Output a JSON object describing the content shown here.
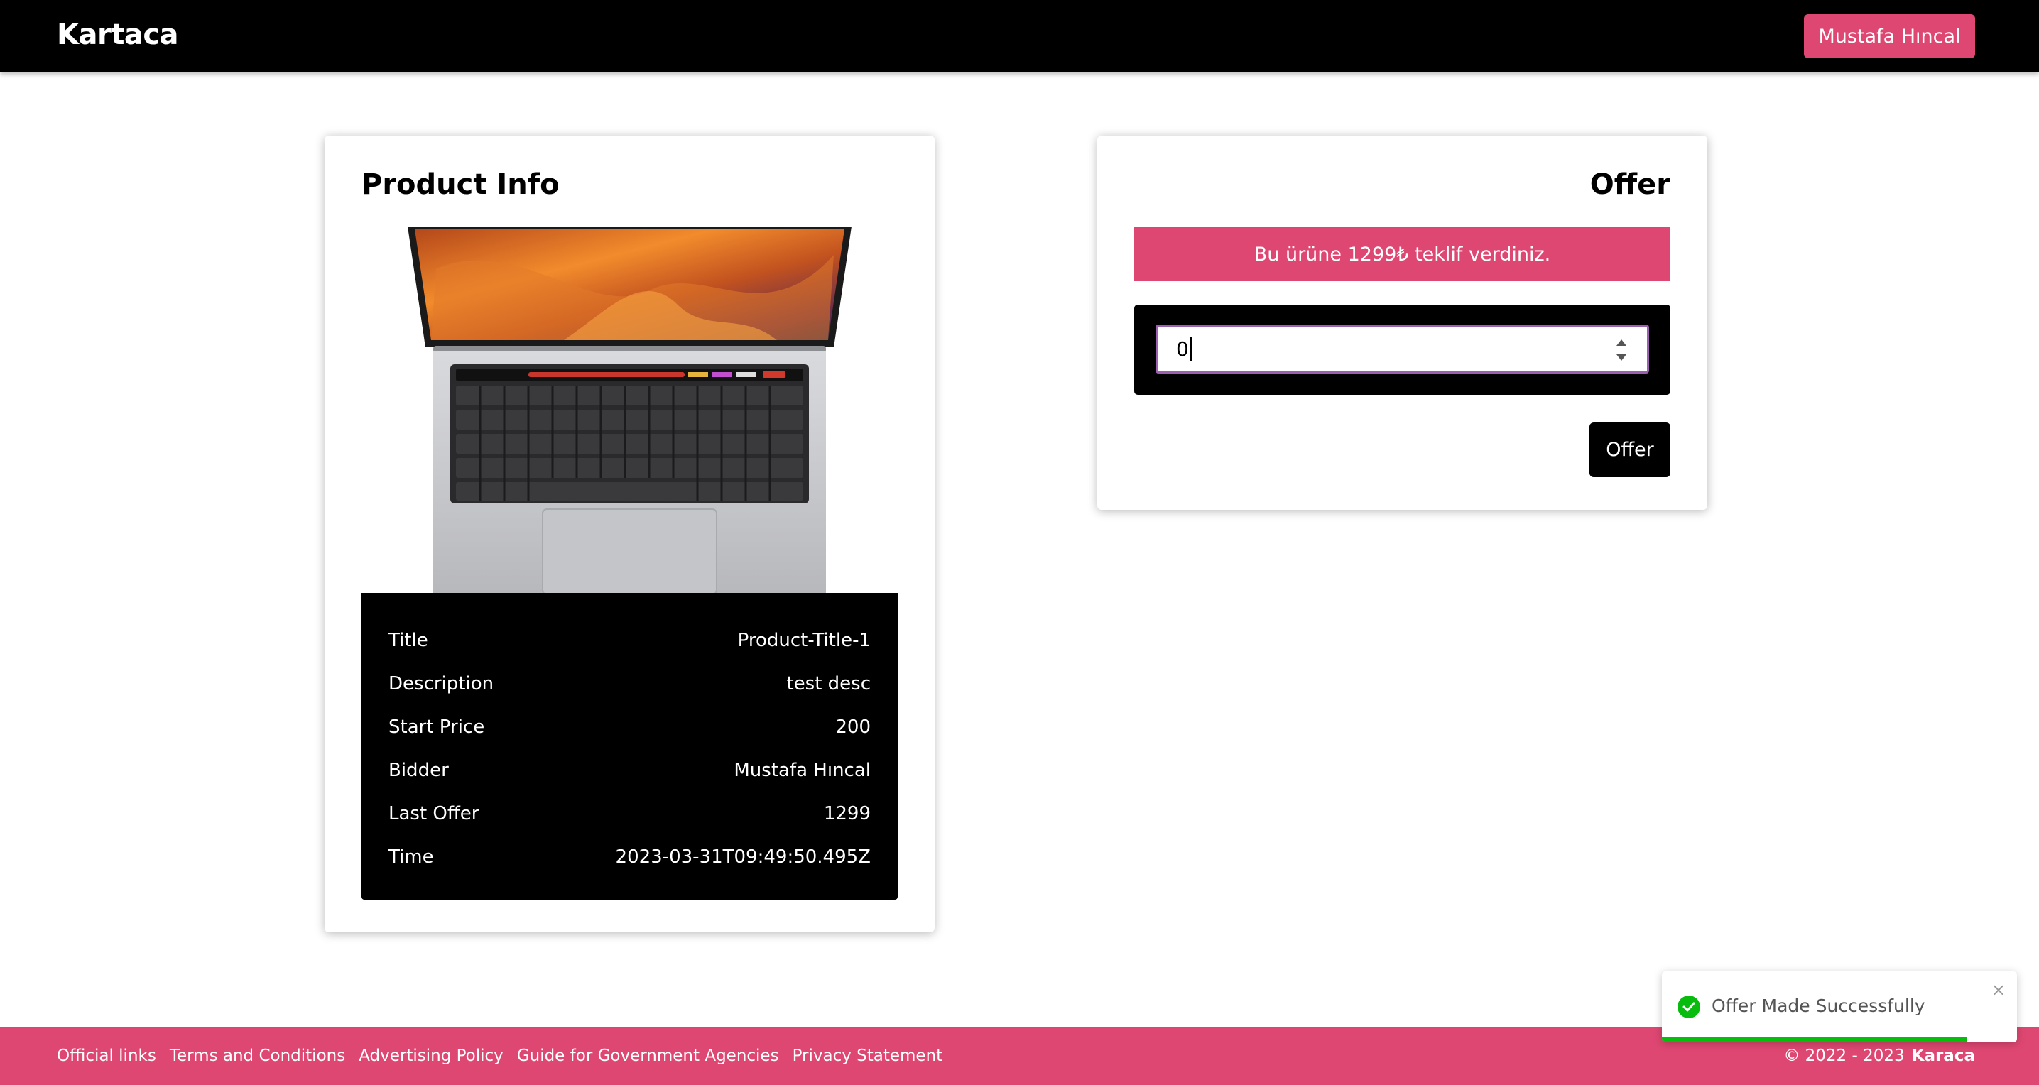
{
  "header": {
    "brand": "Kartaca",
    "user_button": "Mustafa Hıncal"
  },
  "product": {
    "title": "Product Info",
    "image_icon": "laptop-image",
    "rows": [
      {
        "label": "Title",
        "value": "Product-Title-1"
      },
      {
        "label": "Description",
        "value": "test desc"
      },
      {
        "label": "Start Price",
        "value": "200"
      },
      {
        "label": "Bidder",
        "value": "Mustafa Hıncal"
      },
      {
        "label": "Last Offer",
        "value": "1299"
      },
      {
        "label": "Time",
        "value": "2023-03-31T09:49:50.495Z"
      }
    ]
  },
  "offer": {
    "title": "Offer",
    "alert": "Bu ürüne 1299₺ teklif verdiniz.",
    "input_value": "0",
    "button": "Offer"
  },
  "footer": {
    "links": [
      "Official links",
      "Terms and Conditions",
      "Advertising Policy",
      "Guide for Government Agencies",
      "Privacy Statement"
    ],
    "copyright": "© 2022 - 2023",
    "brand": "Karaca"
  },
  "toast": {
    "message": "Offer Made Successfully",
    "close": "×",
    "progress": 0.86
  },
  "colors": {
    "accent": "#de4771",
    "dark": "#000000",
    "success": "#07bc0c"
  }
}
